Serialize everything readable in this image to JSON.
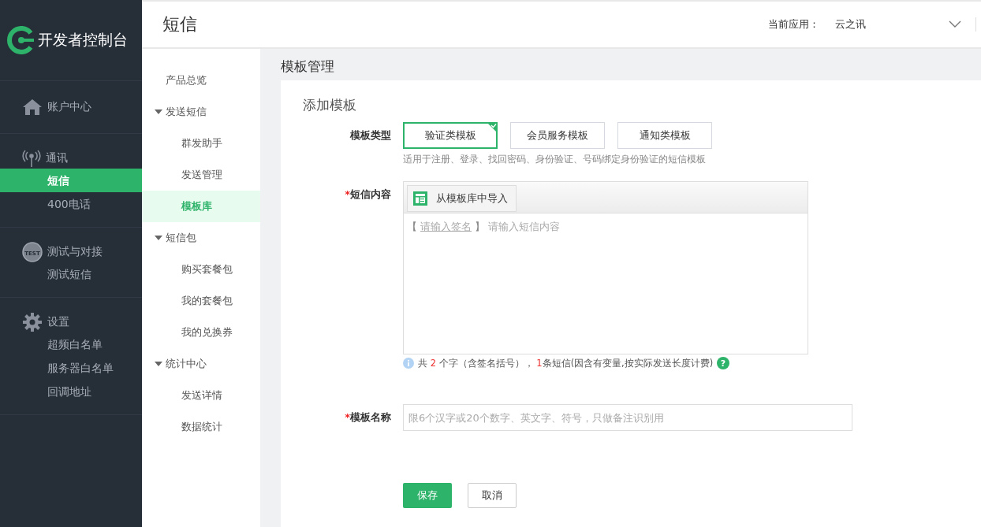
{
  "sidebar": {
    "logo": "开发者控制台",
    "groups": [
      {
        "title": "账户中心"
      },
      {
        "title": "通讯",
        "items": [
          {
            "label": "短信",
            "selected": true
          },
          {
            "label": "400电话",
            "selected": false
          }
        ]
      },
      {
        "badge": "TEST",
        "title": "测试与对接",
        "items": [
          {
            "label": "测试短信",
            "selected": false
          }
        ]
      },
      {
        "title": "设置",
        "items": [
          {
            "label": "超频白名单",
            "selected": false
          },
          {
            "label": "服务器白名单",
            "selected": false
          },
          {
            "label": "回调地址",
            "selected": false
          }
        ]
      }
    ]
  },
  "header": {
    "title": "短信",
    "app_label": "当前应用：",
    "app_value": "云之讯"
  },
  "subnav": [
    {
      "label": "产品总览",
      "selected": false
    },
    {
      "label": "发送短信",
      "expanded": true,
      "children": [
        {
          "label": "群发助手",
          "selected": false
        },
        {
          "label": "发送管理",
          "selected": false
        },
        {
          "label": "模板库",
          "selected": true
        }
      ]
    },
    {
      "label": "短信包",
      "expanded": true,
      "children": [
        {
          "label": "购买套餐包",
          "selected": false
        },
        {
          "label": "我的套餐包",
          "selected": false
        },
        {
          "label": "我的兑换券",
          "selected": false
        }
      ]
    },
    {
      "label": "统计中心",
      "expanded": true,
      "children": [
        {
          "label": "发送详情",
          "selected": false
        },
        {
          "label": "数据统计",
          "selected": false
        }
      ]
    }
  ],
  "page_title": "模板管理",
  "form": {
    "title": "添加模板",
    "type_label": "模板类型",
    "types": [
      {
        "label": "验证类模板",
        "selected": true
      },
      {
        "label": "会员服务模板",
        "selected": false
      },
      {
        "label": "通知类模板",
        "selected": false
      }
    ],
    "type_hint": "适用于注册、登录、找回密码、身份验证、号码绑定身份验证的短信模板",
    "content_label": "短信内容",
    "content_required_mark": "*",
    "import_button": "从模板库中导入",
    "bracket_open": "【",
    "signature_placeholder": "请输入签名",
    "bracket_close": "】",
    "content_placeholder": "请输入短信内容",
    "counter": {
      "prefix": "共",
      "chars": "2",
      "middle": "个字（含签名括号），",
      "messages": "1",
      "suffix": "条短信(因含有变量,按实际发送长度计费)",
      "help": "?"
    },
    "name_label": "模板名称",
    "name_required_mark": "*",
    "name_placeholder": "限6个汉字或20个数字、英文字、符号，只做备注识别用",
    "buttons": [
      {
        "label": "保存",
        "kind": "primary"
      },
      {
        "label": "取消",
        "kind": "secondary"
      }
    ]
  }
}
